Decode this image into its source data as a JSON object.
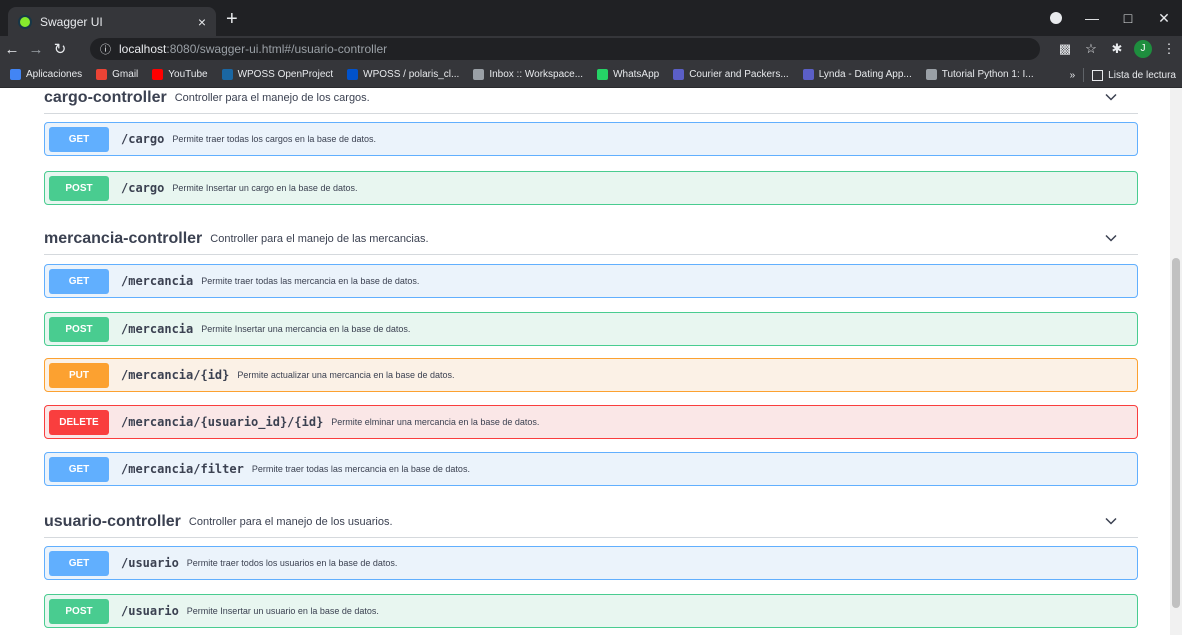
{
  "browser": {
    "tab_title": "Swagger UI",
    "tab_close": "×",
    "new_tab": "+",
    "url_host": "localhost",
    "url_path": ":8080/swagger-ui.html#/usuario-controller",
    "avatar_letter": "J",
    "bookmarks": [
      {
        "label": "Aplicaciones",
        "color": "#4285f4"
      },
      {
        "label": "Gmail",
        "color": "#ea4335"
      },
      {
        "label": "YouTube",
        "color": "#ff0000"
      },
      {
        "label": "WPOSS OpenProject",
        "color": "#1a67a3"
      },
      {
        "label": "WPOSS / polaris_cl...",
        "color": "#0052cc"
      },
      {
        "label": "Inbox :: Workspace...",
        "color": "#9aa0a6"
      },
      {
        "label": "WhatsApp",
        "color": "#25d366"
      },
      {
        "label": "Courier and Packers...",
        "color": "#5b5fc7"
      },
      {
        "label": "Lynda - Dating App...",
        "color": "#5b5fc7"
      },
      {
        "label": "Tutorial Python 1: I...",
        "color": "#9aa0a6"
      }
    ],
    "more_bookmarks": "»",
    "reading_list": "Lista de lectura"
  },
  "sections": [
    {
      "name": "cargo-controller",
      "description": "Controller para el manejo de los cargos.",
      "operations": [
        {
          "method": "GET",
          "path": "/cargo",
          "summary": "Permite traer todas los cargos en la base de datos."
        },
        {
          "method": "POST",
          "path": "/cargo",
          "summary": "Permite Insertar un cargo en la base de datos."
        }
      ]
    },
    {
      "name": "mercancia-controller",
      "description": "Controller para el manejo de las mercancias.",
      "operations": [
        {
          "method": "GET",
          "path": "/mercancia",
          "summary": "Permite traer todas las mercancia en la base de datos."
        },
        {
          "method": "POST",
          "path": "/mercancia",
          "summary": "Permite Insertar una mercancia en la base de datos."
        },
        {
          "method": "PUT",
          "path": "/mercancia/{id}",
          "summary": "Permite actualizar una mercancia en la base de datos."
        },
        {
          "method": "DELETE",
          "path": "/mercancia/{usuario_id}/{id}",
          "summary": "Permite elminar una mercancia en la base de datos."
        },
        {
          "method": "GET",
          "path": "/mercancia/filter",
          "summary": "Permite traer todas las mercancia en la base de datos."
        }
      ]
    },
    {
      "name": "usuario-controller",
      "description": "Controller para el manejo de los usuarios.",
      "operations": [
        {
          "method": "GET",
          "path": "/usuario",
          "summary": "Permite traer todos los usuarios en la base de datos."
        },
        {
          "method": "POST",
          "path": "/usuario",
          "summary": "Permite Insertar un usuario en la base de datos."
        }
      ]
    }
  ],
  "colors": {
    "get": "#61affe",
    "post": "#49cc90",
    "put": "#fca130",
    "delete": "#f93e3e"
  }
}
